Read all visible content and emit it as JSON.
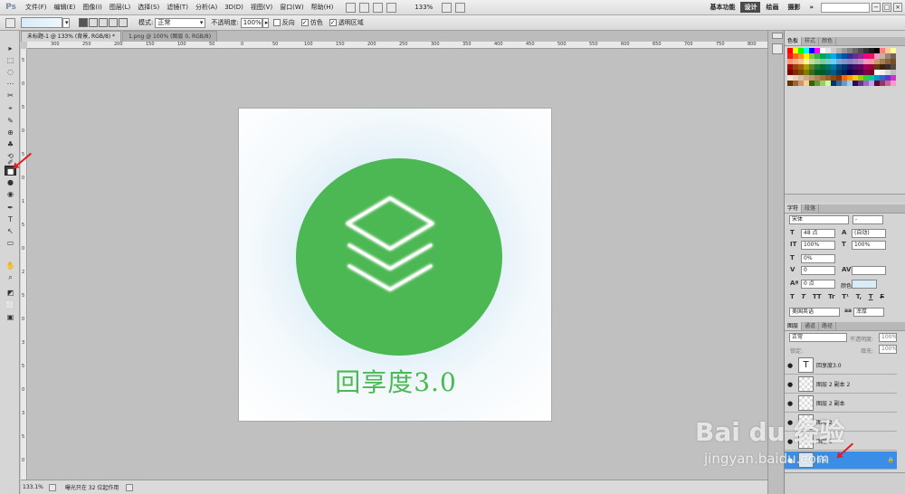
{
  "app": {
    "logo": "Ps"
  },
  "menu": [
    "文件(F)",
    "编辑(E)",
    "图像(I)",
    "图层(L)",
    "选择(S)",
    "滤镜(T)",
    "分析(A)",
    "3D(D)",
    "视图(V)",
    "窗口(W)",
    "帮助(H)"
  ],
  "menubar_right": {
    "zoom": "133%",
    "workspaces": [
      "基本功能",
      "设计",
      "绘画",
      "摄影"
    ],
    "active_workspace": "设计",
    "more": "»"
  },
  "options": {
    "mode_label": "模式:",
    "mode_value": "正常",
    "opacity_label": "不透明度:",
    "opacity_value": "100%",
    "reverse": "反向",
    "dither": "仿色",
    "transparency": "透明区域",
    "dither_checked": "✓",
    "transparency_checked": "✓"
  },
  "tabs": [
    "未标题-1 @ 133% (背景, RGB/8) *",
    "1.png @ 100% (图层 0, RGB/8)"
  ],
  "ruler_h": [
    "300",
    "250",
    "200",
    "150",
    "100",
    "50",
    "0",
    "50",
    "100",
    "150",
    "200",
    "250",
    "300",
    "350",
    "400",
    "450",
    "500",
    "550",
    "600",
    "650",
    "700",
    "750",
    "800"
  ],
  "ruler_v": [
    "5",
    "0",
    "5",
    "0",
    "5",
    "0",
    "1",
    "5",
    "0",
    "2",
    "5",
    "0",
    "3",
    "5",
    "0",
    "3",
    "5",
    "0"
  ],
  "document": {
    "caption": "回享度3.0"
  },
  "status": {
    "zoom": "133.1%",
    "message": "曝光只在 32 位起作用"
  },
  "swatch_colors": [
    "#ff0000",
    "#ffff00",
    "#00ff00",
    "#00ffff",
    "#0000ff",
    "#ff00ff",
    "#ffffff",
    "#e6e6e6",
    "#cccccc",
    "#b3b3b3",
    "#999999",
    "#808080",
    "#666666",
    "#4d4d4d",
    "#333333",
    "#1a1a1a",
    "#000000",
    "#ff8080",
    "#ffcc99",
    "#ffff99",
    "#ed1c24",
    "#f26522",
    "#f7941d",
    "#fff200",
    "#8dc63f",
    "#39b54a",
    "#00a651",
    "#00a99d",
    "#00aeef",
    "#0072bc",
    "#0054a6",
    "#2e3192",
    "#662d91",
    "#92278f",
    "#ec008c",
    "#ed145b",
    "#f49ac2",
    "#c7b299",
    "#998675",
    "#736357",
    "#f7977a",
    "#f9ad81",
    "#fdc68a",
    "#fff79a",
    "#c4df9b",
    "#a3d39c",
    "#82ca9d",
    "#7bcdc8",
    "#6ecff6",
    "#7ea7d8",
    "#8493ca",
    "#8882be",
    "#a187be",
    "#bc8dbf",
    "#f49ac1",
    "#f6989d",
    "#c69c6d",
    "#a67c52",
    "#8c6239",
    "#754c24",
    "#9e0b0f",
    "#a0410d",
    "#a36209",
    "#aba000",
    "#598527",
    "#1a7b30",
    "#007236",
    "#00746b",
    "#0076a3",
    "#004b80",
    "#003471",
    "#1b1464",
    "#440e62",
    "#630460",
    "#9e005d",
    "#9e0039",
    "#603913",
    "#42210b",
    "#362f2d",
    "#534741",
    "#790000",
    "#7b2e00",
    "#7d4900",
    "#827b00",
    "#406618",
    "#005e20",
    "#005826",
    "#005952",
    "#005b7f",
    "#003663",
    "#002157",
    "#0d004c",
    "#32004b",
    "#4b0049",
    "#7b0046",
    "#7a0026",
    "#ffffff",
    "#f2f2f2",
    "#d9d9d9",
    "#bfbfbf",
    "#f2e6d9",
    "#e6d2bf",
    "#d9bfa6",
    "#ccab8c",
    "#bf9873",
    "#b38459",
    "#a67040",
    "#995d26",
    "#8c490d",
    "#803600",
    "#ff6600",
    "#ff9900",
    "#ffcc00",
    "#99cc00",
    "#33cc33",
    "#00cc99",
    "#0099cc",
    "#3366cc",
    "#6633cc",
    "#cc33cc",
    "#663300",
    "#996633",
    "#cc9966",
    "#ffcc99",
    "#336600",
    "#669933",
    "#99cc66",
    "#ccff99",
    "#003366",
    "#336699",
    "#6699cc",
    "#99ccff",
    "#330066",
    "#663399",
    "#9966cc",
    "#cc99ff",
    "#660033",
    "#993366",
    "#cc6699",
    "#ff99cc"
  ],
  "swatches_panel": {
    "tabs": [
      "色板",
      "样式",
      "颜色"
    ]
  },
  "character_panel": {
    "tabs": [
      "字符",
      "段落"
    ],
    "font": "宋体",
    "style": "-",
    "size": "48 点",
    "leading": "(自动)",
    "v_scale": "100%",
    "h_scale": "100%",
    "tracking_pct": "0%",
    "kerning": "0",
    "tracking": "",
    "baseline": "0 点",
    "color_label": "颜色:",
    "language": "美国英语",
    "anti_alias": "浑厚",
    "style_buttons": [
      "T",
      "T",
      "TT",
      "Tr",
      "T¹",
      "T,",
      "T",
      "F"
    ],
    "icon_letters": {
      "size": "T",
      "leading": "A",
      "vscale": "IT",
      "hscale": "T",
      "tracking_pct": "T",
      "kerning": "V",
      "tracking": "AV",
      "baseline": "Aª"
    }
  },
  "layers_panel": {
    "tabs": [
      "图层",
      "通道",
      "路径"
    ],
    "blend": "正常",
    "opacity_label": "不透明度:",
    "opacity": "100%",
    "lock_label": "锁定:",
    "fill_label": "填充:",
    "fill": "100%",
    "layers": [
      {
        "name": "回享度3.0",
        "type": "text",
        "thumb": "T",
        "visible": "●",
        "active": false
      },
      {
        "name": "图层 2 副本 2",
        "type": "pixel",
        "thumb": "",
        "visible": "●",
        "active": false
      },
      {
        "name": "图层 2 副本",
        "type": "pixel",
        "thumb": "",
        "visible": "●",
        "active": false
      },
      {
        "name": "图层 2",
        "type": "pixel",
        "thumb": "",
        "visible": "●",
        "active": false
      },
      {
        "name": "图层 1",
        "type": "pixel",
        "thumb": "",
        "visible": "●",
        "active": false
      },
      {
        "name": "背景",
        "type": "background",
        "thumb": "",
        "visible": "●",
        "active": true,
        "lock": "🔒"
      }
    ]
  },
  "tools": [
    "▸",
    "⬚",
    "◌",
    "⋯",
    "✂",
    "⌖",
    "✎",
    "⊕",
    "♣",
    "⟲",
    "✐",
    "■",
    "●",
    "◉",
    "✒",
    "T",
    "↖",
    "▭",
    "✋",
    "⌕",
    "◩",
    "⬜",
    "▣"
  ],
  "colors": {
    "accent": "#3a8ee8",
    "green": "#4cb853",
    "arrow": "#e02020"
  },
  "watermark": {
    "brand": "Bai du 经验",
    "url": "jingyan.baidu.com"
  }
}
